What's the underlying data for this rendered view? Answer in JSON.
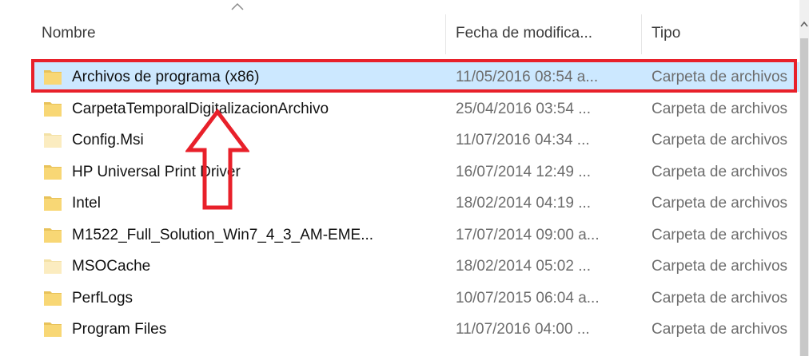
{
  "columns": {
    "name": "Nombre",
    "date": "Fecha de modifica...",
    "type": "Tipo"
  },
  "rows": [
    {
      "name": "Archivos de programa (x86)",
      "date": "11/05/2016 08:54 a...",
      "type": "Carpeta de archivos",
      "selected": true,
      "icon": "folder-icon"
    },
    {
      "name": "CarpetaTemporalDigitalizacionArchivo",
      "date": "25/04/2016 03:54 ...",
      "type": "Carpeta de archivos",
      "icon": "folder-icon"
    },
    {
      "name": "Config.Msi",
      "date": "11/07/2016 04:34 ...",
      "type": "Carpeta de archivos",
      "icon": "folder-hidden-icon"
    },
    {
      "name": "HP Universal Print Driver",
      "date": "16/07/2014 12:49 ...",
      "type": "Carpeta de archivos",
      "icon": "folder-icon"
    },
    {
      "name": "Intel",
      "date": "18/02/2014 04:19 ...",
      "type": "Carpeta de archivos",
      "icon": "folder-icon"
    },
    {
      "name": "M1522_Full_Solution_Win7_4_3_AM-EME...",
      "date": "17/07/2014 09:00 a...",
      "type": "Carpeta de archivos",
      "icon": "folder-icon"
    },
    {
      "name": "MSOCache",
      "date": "18/02/2014 05:02 ...",
      "type": "Carpeta de archivos",
      "icon": "folder-hidden-icon"
    },
    {
      "name": "PerfLogs",
      "date": "10/07/2015 06:04 a...",
      "type": "Carpeta de archivos",
      "icon": "folder-icon"
    },
    {
      "name": "Program Files",
      "date": "11/07/2016 04:00 ...",
      "type": "Carpeta de archivos",
      "icon": "folder-icon"
    }
  ],
  "colors": {
    "selection": "#cce8ff",
    "annotation": "#e8202a",
    "folder": "#f8d775",
    "folder_hidden": "#fbecc0"
  }
}
